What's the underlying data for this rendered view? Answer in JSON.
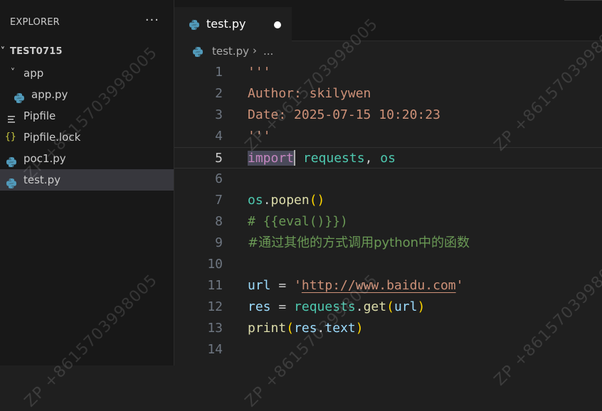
{
  "explorer": {
    "title": "EXPLORER",
    "more_label": "···",
    "items": [
      {
        "label": "TEST0715",
        "type": "root",
        "chevron": "˅"
      },
      {
        "label": "app",
        "type": "folder",
        "chevron": "˅"
      },
      {
        "label": "app.py",
        "type": "python"
      },
      {
        "label": "Pipfile",
        "type": "text"
      },
      {
        "label": "Pipfile.lock",
        "type": "json"
      },
      {
        "label": "poc1.py",
        "type": "python"
      },
      {
        "label": "test.py",
        "type": "python",
        "selected": true
      }
    ]
  },
  "tab": {
    "label": "test.py",
    "dirty": true
  },
  "breadcrumb": {
    "file": "test.py",
    "separator": "›",
    "symbol": "..."
  },
  "code_lines": [
    {
      "n": "1",
      "text": "'''"
    },
    {
      "n": "2",
      "text": "Author: skilywen"
    },
    {
      "n": "3",
      "text": "Date: 2025-07-15 10:20:23"
    },
    {
      "n": "4",
      "text": "'''"
    },
    {
      "n": "5",
      "text": "import requests, os",
      "active": true
    },
    {
      "n": "6",
      "text": ""
    },
    {
      "n": "7",
      "text": "os.popen()"
    },
    {
      "n": "8",
      "text": "# {{eval()}})"
    },
    {
      "n": "9",
      "text": "#通过其他的方式调用python中的函数"
    },
    {
      "n": "10",
      "text": ""
    },
    {
      "n": "11",
      "text": "url = 'http://www.baidu.com'"
    },
    {
      "n": "12",
      "text": "res = requests.get(url)"
    },
    {
      "n": "13",
      "text": "print(res.text)"
    },
    {
      "n": "14",
      "text": ""
    }
  ],
  "watermark": "ZP +8615703998005",
  "colors": {
    "string": "#ce9178",
    "comment": "#6a9955",
    "keyword": "#c586c0",
    "variable": "#9cdcfe",
    "function": "#dcdcaa"
  }
}
